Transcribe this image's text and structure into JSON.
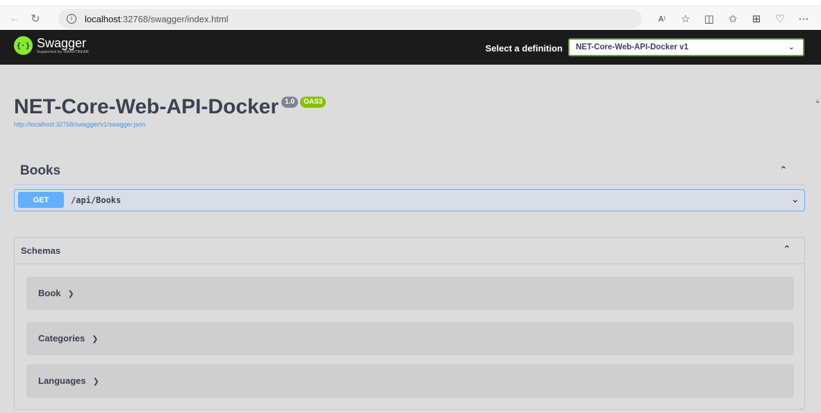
{
  "browser": {
    "url_host": "localhost",
    "url_rest": ":32768/swagger/index.html",
    "icons": [
      "back-icon",
      "refresh-icon",
      "info-icon",
      "read-aloud-icon",
      "favorite-star-icon",
      "split-screen-icon",
      "favorites-list-icon",
      "collections-icon",
      "health-icon",
      "more-icon"
    ]
  },
  "topbar": {
    "logo_title": "Swagger",
    "logo_sub": "Supported by SMARTBEAR",
    "definition_label": "Select a definition",
    "definition_value": "NET-Core-Web-API-Docker v1"
  },
  "info": {
    "title": "NET-Core-Web-API-Docker",
    "version": "1.0",
    "oas": "OAS3",
    "url": "http://localhost:32768/swagger/v1/swagger.json"
  },
  "tag": {
    "name": "Books",
    "operations": [
      {
        "method": "GET",
        "path": "/api/Books"
      }
    ]
  },
  "schemas": {
    "title": "Schemas",
    "models": [
      "Book",
      "Categories",
      "Languages"
    ]
  },
  "colors": {
    "get_method": "#61affe",
    "swagger_green": "#85ea2d",
    "oas_badge": "#89bf04",
    "topbar": "#1b1b1b"
  }
}
